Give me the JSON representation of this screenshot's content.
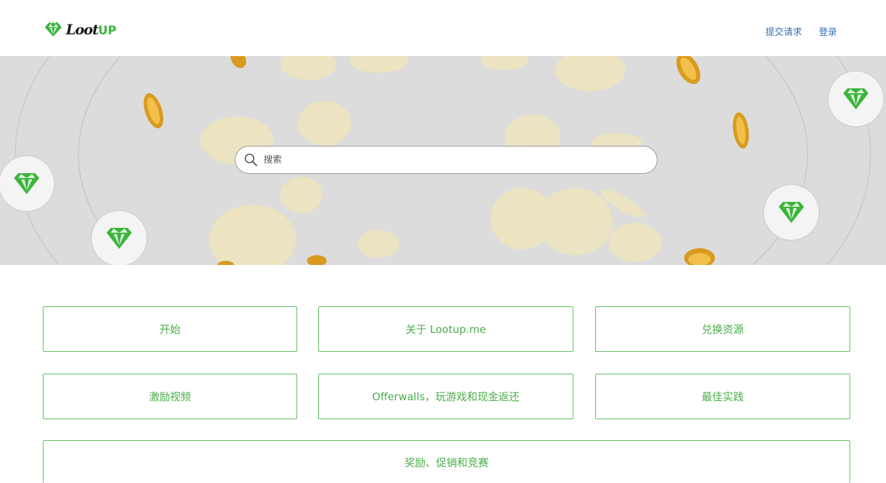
{
  "header": {
    "logo_text": "LootUP",
    "nav": {
      "submit_request": "提交请求",
      "login": "登录"
    }
  },
  "hero": {
    "search": {
      "placeholder": "搜索"
    }
  },
  "categories": [
    "开始",
    "关于 Lootup.me",
    "兑换资源",
    "激励视频",
    "Offerwalls，玩游戏和现金返还",
    "最佳实践",
    "奖励、促销和竞赛"
  ],
  "colors": {
    "brand_green": "#3cb43c",
    "link_blue": "#2f6fb8",
    "hero_bg": "#dcdcdc",
    "coin_gold": "#e8b23a"
  },
  "icons": {
    "logo": "diamond-icon",
    "search": "search-icon",
    "hero_badges": "diamond-icon"
  }
}
